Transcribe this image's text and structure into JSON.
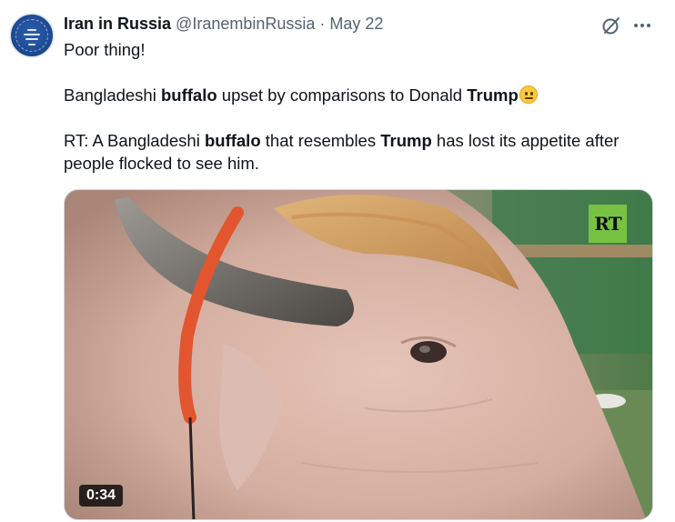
{
  "author": {
    "name": "Iran in Russia",
    "handle": "@IranembinRussia",
    "separator": "·",
    "date": "May 22"
  },
  "actions": {
    "grok_icon": "grok-icon",
    "more_icon": "more-icon"
  },
  "text": {
    "line1": "Poor thing!",
    "para2_part1": "Bangladeshi ",
    "para2_bold1": "buffalo",
    "para2_part2": " upset by comparisons to Donald ",
    "para2_bold2": "Trump",
    "para2_emoji": "neutral-face-emoji",
    "para3_part1": "RT: A Bangladeshi ",
    "para3_bold1": "buffalo",
    "para3_part2": " that resembles ",
    "para3_bold2": "Trump",
    "para3_part3": " has lost its appetite after people flocked to see him."
  },
  "media": {
    "watermark": "RT",
    "duration": "0:34"
  },
  "colors": {
    "text": "#0f1419",
    "secondary": "#536471",
    "rt_green": "#77c242"
  }
}
